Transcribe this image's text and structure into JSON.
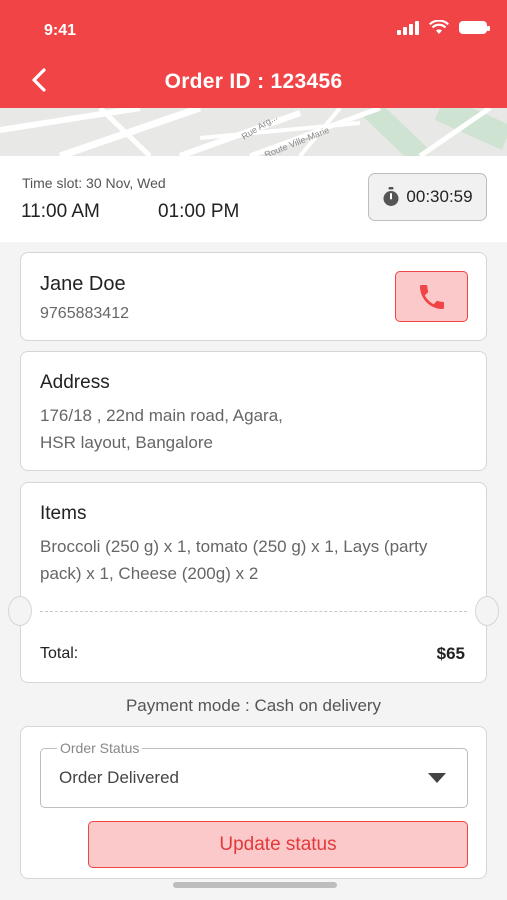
{
  "status_bar": {
    "time": "9:41"
  },
  "header": {
    "title": "Order ID : 123456",
    "back_icon": "chevron-left-icon"
  },
  "map": {
    "street_labels": [
      "Rue Arg...",
      "Route Ville-Marie"
    ]
  },
  "time_slot": {
    "label": "Time slot: 30 Nov, Wed",
    "start": "11:00 AM",
    "end": "01:00 PM",
    "timer": "00:30:59"
  },
  "customer": {
    "name": "Jane Doe",
    "phone": "9765883412",
    "call_icon": "phone-icon"
  },
  "address": {
    "heading": "Address",
    "line1": "176/18 , 22nd main road, Agara,",
    "line2": "HSR layout, Bangalore"
  },
  "items": {
    "heading": "Items",
    "line1": "Broccoli (250 g) x 1, tomato (250 g) x 1, Lays (party",
    "line2": "pack) x 1, Cheese (200g) x 2",
    "total_label": "Total:",
    "total_value": "$65"
  },
  "payment": {
    "text": "Payment mode : Cash on delivery"
  },
  "order_status": {
    "legend": "Order Status",
    "selected": "Order Delivered",
    "update_label": "Update status"
  },
  "colors": {
    "accent": "#f04446",
    "accent_light": "#fbc9c9"
  }
}
